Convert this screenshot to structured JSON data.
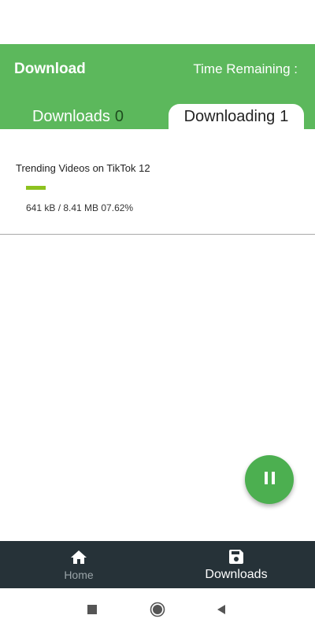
{
  "header": {
    "title": "Download",
    "time_remaining_label": "Time Remaining :"
  },
  "tabs": [
    {
      "label": "Downloads",
      "count": "0",
      "selected": false
    },
    {
      "label": "Downloading",
      "count": "1",
      "selected": true
    }
  ],
  "downloads": [
    {
      "title": "Trending Videos on TikTok 12",
      "size_text": "641 kB / 8.41 MB 07.62%",
      "progress": 0.0762
    }
  ],
  "fab": {
    "icon": "pause-icon"
  },
  "bottom_nav": {
    "items": [
      {
        "label": "Home",
        "icon": "home-icon",
        "active": false
      },
      {
        "label": "Downloads",
        "icon": "save-icon",
        "active": true
      }
    ]
  },
  "system_nav": {
    "buttons": [
      "recents-square-icon",
      "home-circle-icon",
      "back-triangle-icon"
    ]
  },
  "colors": {
    "primary": "#5cb85c",
    "fab": "#4caf50",
    "progress": "#8dc21f",
    "bottom_nav": "#263238"
  }
}
